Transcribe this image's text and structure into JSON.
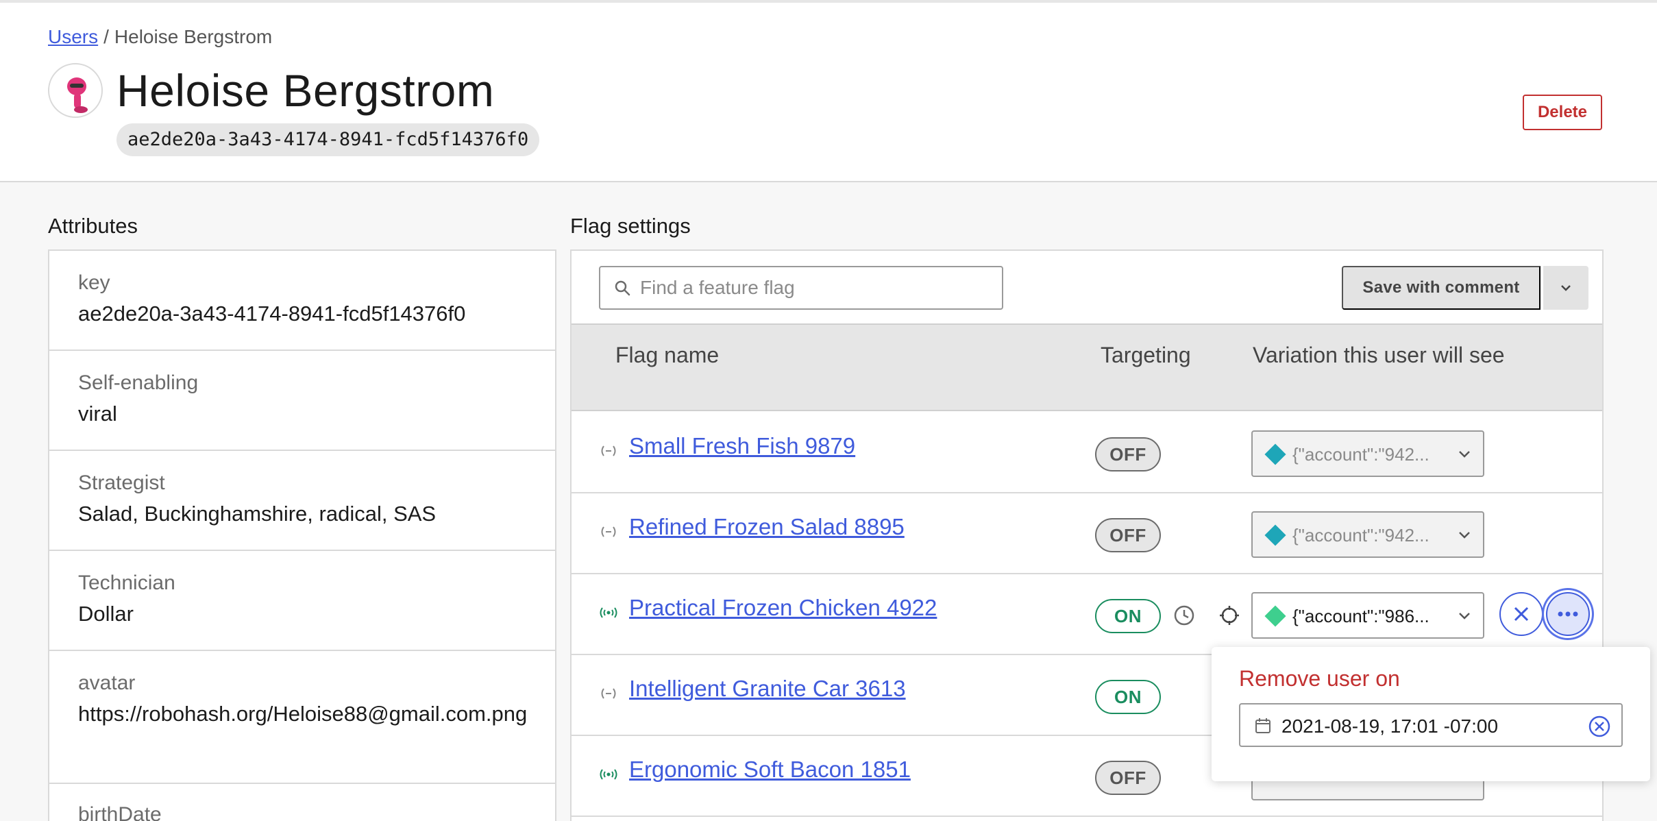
{
  "breadcrumb": {
    "parent": "Users",
    "separator": "/",
    "current": "Heloise Bergstrom"
  },
  "user": {
    "name": "Heloise Bergstrom",
    "key": "ae2de20a-3a43-4174-8941-fcd5f14376f0"
  },
  "header": {
    "delete_label": "Delete"
  },
  "attributes": {
    "title": "Attributes",
    "items": [
      {
        "name": "key",
        "value": "ae2de20a-3a43-4174-8941-fcd5f14376f0"
      },
      {
        "name": "Self-enabling",
        "value": "viral"
      },
      {
        "name": "Strategist",
        "value": "Salad, Buckinghamshire, radical, SAS"
      },
      {
        "name": "Technician",
        "value": "Dollar"
      },
      {
        "name": "avatar",
        "value": "https://robohash.org/Heloise88@gmail.com.png"
      },
      {
        "name": "birthDate",
        "value": ""
      }
    ]
  },
  "flag_settings": {
    "title": "Flag settings",
    "search_placeholder": "Find a feature flag",
    "save_label": "Save with comment",
    "columns": {
      "name": "Flag name",
      "targeting": "Targeting",
      "variation": "Variation this user will see"
    },
    "rows": [
      {
        "name": "Small Fresh Fish 9879",
        "targeting": "OFF",
        "variation": "{\"account\":\"942...",
        "status_icon": "inactive-icon",
        "color": "#1ea6b8"
      },
      {
        "name": "Refined Frozen Salad 8895",
        "targeting": "OFF",
        "variation": "{\"account\":\"942...",
        "status_icon": "inactive-icon",
        "color": "#1ea6b8"
      },
      {
        "name": "Practical Frozen Chicken 4922",
        "targeting": "ON",
        "variation": "{\"account\":\"986...",
        "status_icon": "live-icon",
        "color": "#3ecf8e"
      },
      {
        "name": "Intelligent Granite Car 3613",
        "targeting": "ON",
        "variation": "",
        "status_icon": "inactive-icon",
        "color": "#1ea6b8"
      },
      {
        "name": "Ergonomic Soft Bacon 1851",
        "targeting": "OFF",
        "variation": "",
        "status_icon": "live-icon",
        "color": "#1ea6b8"
      }
    ]
  },
  "popover": {
    "title": "Remove user on",
    "date_value": "2021-08-19, 17:01 -07:00"
  },
  "colors": {
    "link": "#3f5bdc",
    "danger": "#c23030",
    "on": "#1a8d5f"
  }
}
